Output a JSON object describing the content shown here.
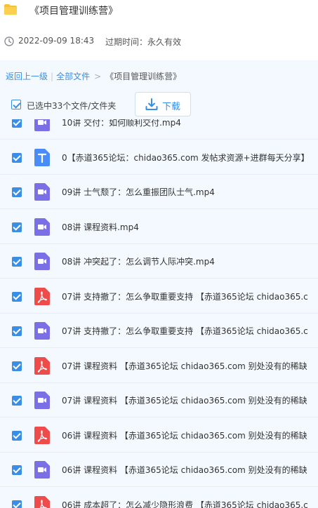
{
  "header": {
    "folder_title": "《项目管理训练营》",
    "date": "2022-09-09 18:43",
    "expire": "过期时间：永久有效"
  },
  "breadcrumb": {
    "back": "返回上一级",
    "sep": "|",
    "all_files": "全部文件",
    "arrow": ">",
    "current": "《项目管理训练营》"
  },
  "toolbar": {
    "selected_label": "已选中33个文件/文件夹",
    "download_label": "下载"
  },
  "files": [
    {
      "name": "10讲 交付：如何顺利交付.mp4",
      "icon": "video-file-icon"
    },
    {
      "name": "0【赤道365论坛：chidao365.com 发帖求资源+进群每天分享】",
      "icon": "text-file-icon"
    },
    {
      "name": "09讲 士气颓了：怎么重振团队士气.mp4",
      "icon": "video-file-icon"
    },
    {
      "name": "08讲 课程资料.mp4",
      "icon": "video-file-icon"
    },
    {
      "name": "08讲 冲突起了：怎么调节人际冲突.mp4",
      "icon": "video-file-icon"
    },
    {
      "name": "07讲 支持撤了：怎么争取重要支持 【赤道365论坛 chidao365.c",
      "icon": "pdf-file-icon"
    },
    {
      "name": "07讲 支持撤了：怎么争取重要支持 【赤道365论坛 chidao365.c",
      "icon": "video-file-icon"
    },
    {
      "name": "07讲 课程资料 【赤道365论坛 chidao365.com 别处没有的稀缺",
      "icon": "pdf-file-icon"
    },
    {
      "name": "07讲 课程资料 【赤道365论坛 chidao365.com 别处没有的稀缺",
      "icon": "video-file-icon"
    },
    {
      "name": "06讲 课程资料 【赤道365论坛 chidao365.com 别处没有的稀缺",
      "icon": "pdf-file-icon"
    },
    {
      "name": "06讲 课程资料 【赤道365论坛 chidao365.com 别处没有的稀缺",
      "icon": "video-file-icon"
    },
    {
      "name": "06讲 成本超了：怎么减少隐形浪费 【赤道365论坛 chidao365.c",
      "icon": "pdf-file-icon"
    }
  ],
  "colors": {
    "accent": "#3a8ee6",
    "video_icon": "#7b6fe6",
    "text_icon": "#4a8cf7",
    "pdf_icon": "#f04b4b",
    "folder_icon": "#f7c23a"
  }
}
